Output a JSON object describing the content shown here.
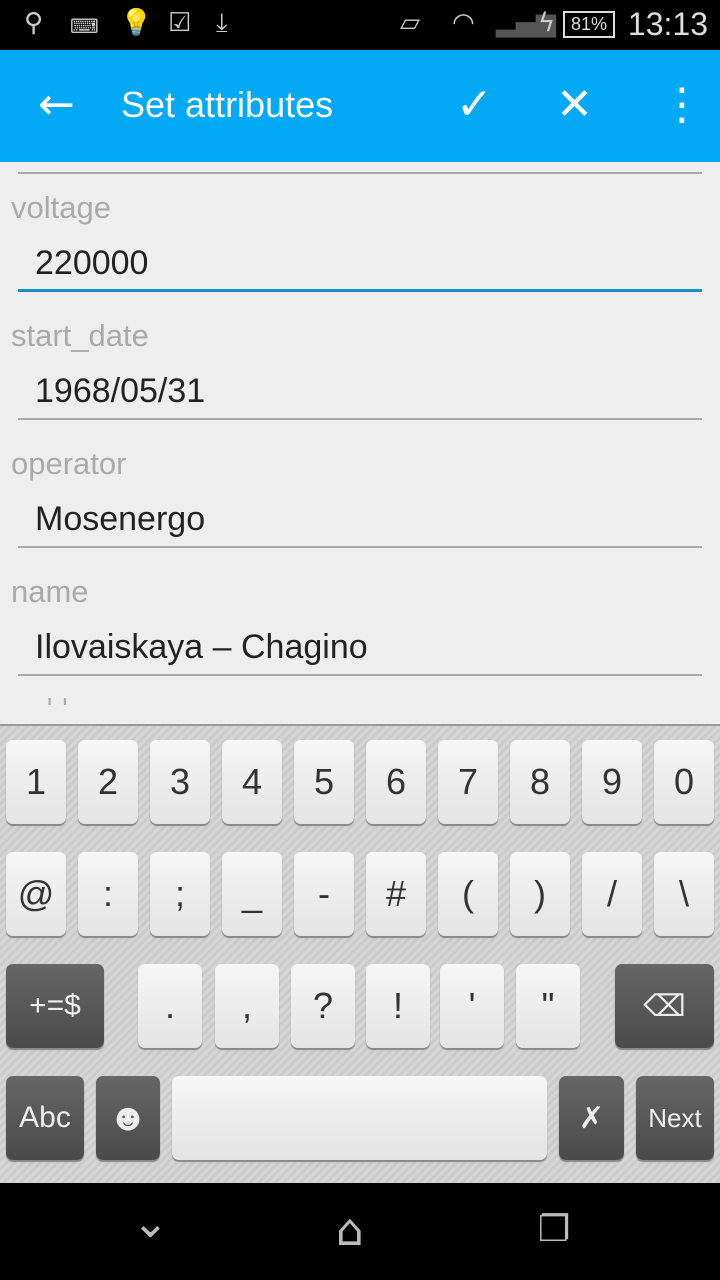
{
  "status_bar": {
    "battery": "81%",
    "time": "13:13",
    "icons": [
      "usb-icon",
      "keyboard-icon",
      "lightbulb-icon",
      "checkbox-icon",
      "download-icon",
      "vibrate-icon",
      "wifi-icon",
      "signal-icon",
      "charging-icon",
      "battery-icon"
    ]
  },
  "app_bar": {
    "title": "Set attributes",
    "back_icon": "arrow-left-icon",
    "confirm_icon": "check-icon",
    "cancel_icon": "close-icon",
    "menu_icon": "overflow-menu-icon"
  },
  "fields": [
    {
      "label": "voltage",
      "value": "220000",
      "focused": true
    },
    {
      "label": "start_date",
      "value": "1968/05/31"
    },
    {
      "label": "operator",
      "value": "Mosenergo"
    },
    {
      "label": "name",
      "value": "Ilovaiskaya – Chagino"
    }
  ],
  "partial_next_label": "' '",
  "keyboard": {
    "row1": [
      "1",
      "2",
      "3",
      "4",
      "5",
      "6",
      "7",
      "8",
      "9",
      "0"
    ],
    "row2": [
      "@",
      ":",
      ";",
      "_",
      "-",
      "#",
      "(",
      ")",
      "/",
      "\\"
    ],
    "row3_symbols": [
      "+=$"
    ],
    "row3": [
      ".",
      ",",
      "?",
      "!",
      "'",
      "\""
    ],
    "abc": "Abc",
    "next": "Next"
  }
}
